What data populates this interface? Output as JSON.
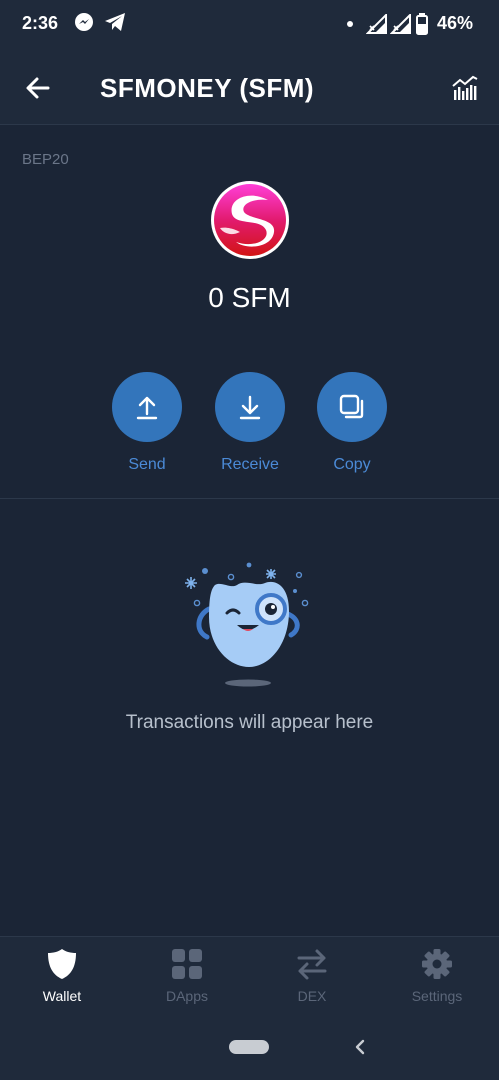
{
  "status_bar": {
    "time": "2:36",
    "battery_percent": "46%",
    "icons": [
      "messenger-icon",
      "telegram-icon",
      "dot-icon",
      "signal-icon",
      "signal-icon",
      "battery-icon"
    ]
  },
  "header": {
    "title": "SFMONEY (SFM)",
    "back_icon": "arrow-left-icon",
    "chart_icon": "price-chart-icon"
  },
  "token": {
    "network": "BEP20",
    "balance": "0 SFM",
    "logo_icon": "sfm-logo-icon"
  },
  "actions": [
    {
      "label": "Send",
      "icon": "upload-arrow-icon"
    },
    {
      "label": "Receive",
      "icon": "download-arrow-icon"
    },
    {
      "label": "Copy",
      "icon": "copy-icon"
    }
  ],
  "empty_state": {
    "message": "Transactions will appear here",
    "illustration": "monocle-mascot-icon"
  },
  "bottom_nav": {
    "items": [
      {
        "label": "Wallet",
        "icon": "shield-icon",
        "active": true
      },
      {
        "label": "DApps",
        "icon": "grid-icon",
        "active": false
      },
      {
        "label": "DEX",
        "icon": "swap-arrows-icon",
        "active": false
      },
      {
        "label": "Settings",
        "icon": "gear-icon",
        "active": false
      }
    ]
  },
  "colors": {
    "background": "#1b2536",
    "accent": "#3375bb",
    "accent_text": "#4b8ad6",
    "muted_text": "#5b6679"
  }
}
